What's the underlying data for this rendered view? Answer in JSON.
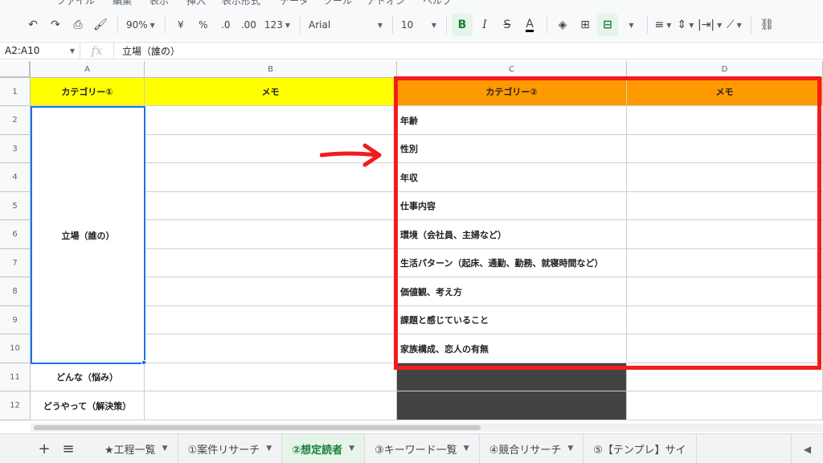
{
  "menu": [
    "ファイル",
    "編集",
    "表示",
    "挿入",
    "表示形式",
    "データ",
    "ツール",
    "アドオン",
    "ヘルプ"
  ],
  "toolbar": {
    "zoom": "90%",
    "currency": "¥",
    "percent": "%",
    "dec_less": ".0",
    "dec_more": ".00",
    "number_format": "123",
    "font": "Arial",
    "font_size": "10",
    "bold": "B",
    "italic": "I",
    "strike": "S",
    "text_color": "A"
  },
  "formula_bar": {
    "name_box": "A2:A10",
    "fx": "fx",
    "content": "立場（誰の）"
  },
  "columns": [
    "A",
    "B",
    "C",
    "D"
  ],
  "rows": [
    "1",
    "2",
    "3",
    "4",
    "5",
    "6",
    "7",
    "8",
    "9",
    "10",
    "11",
    "12"
  ],
  "header_row": {
    "a": "カテゴリー①",
    "b": "メモ",
    "c": "カテゴリー②",
    "d": "メモ"
  },
  "column_a": {
    "merged": "立場（誰の）",
    "row11": "どんな（悩み）",
    "row12": "どうやって（解決策）"
  },
  "column_c": [
    "年齢",
    "性別",
    "年収",
    "仕事内容",
    "環境（会社員、主婦など）",
    "生活パターン（起床、通勤、勤務、就寝時間など）",
    "価値観、考え方",
    "課題と感じていること",
    "家族構成、恋人の有無"
  ],
  "tabs": [
    "★工程一覧",
    "①案件リサーチ",
    "②想定読者",
    "③キーワード一覧",
    "④競合リサーチ",
    "⑤【テンプレ】サイ"
  ],
  "active_tab": "②想定読者",
  "colors": {
    "header_yellow": "#ffff00",
    "header_orange": "#ff9900",
    "highlight_red": "#f21c1c",
    "dark_fill": "#434343",
    "selection_blue": "#1a73e8"
  }
}
